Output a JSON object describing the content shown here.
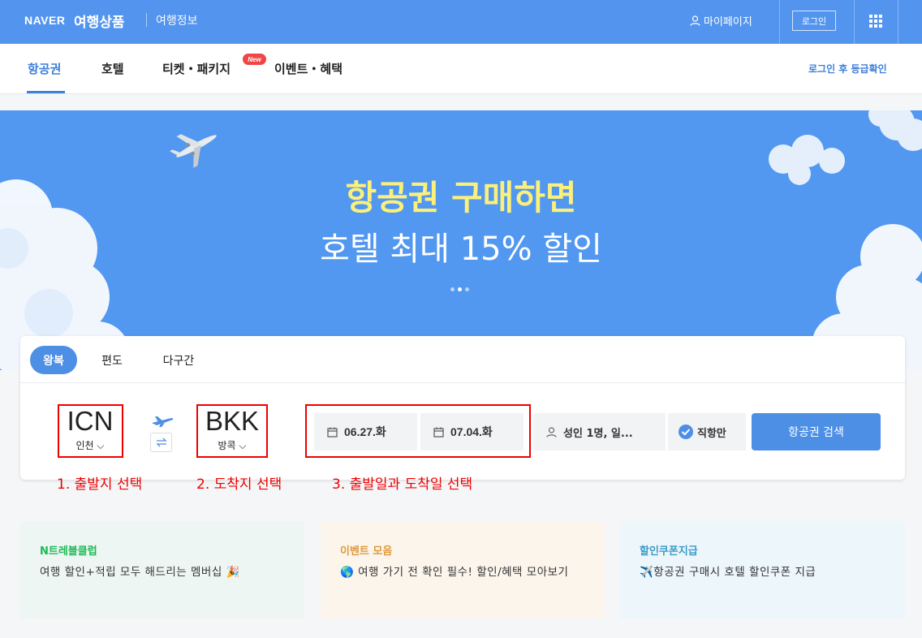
{
  "header": {
    "brand": "NAVER",
    "title": "여행상품",
    "info_link": "여행정보",
    "mypage": "마이페이지",
    "login": "로그인"
  },
  "nav": {
    "tabs": [
      {
        "label": "항공권",
        "active": true
      },
      {
        "label": "호텔"
      },
      {
        "label": "티켓・패키지",
        "badge": "New"
      },
      {
        "label": "이벤트・혜택"
      }
    ],
    "right_link": "로그인 후 등급확인"
  },
  "banner": {
    "line1": "항공권 구매하면",
    "line2": "호텔 최대 15% 할인",
    "slide_count": 3,
    "active_slide": 2
  },
  "search": {
    "trip_tabs": [
      "왕복",
      "편도",
      "다구간"
    ],
    "active_trip": "왕복",
    "origin": {
      "code": "ICN",
      "city": "인천"
    },
    "destination": {
      "code": "BKK",
      "city": "방콕"
    },
    "depart_date": "06.27.화",
    "return_date": "07.04.화",
    "passengers": "성인 1명, 일...",
    "direct_only": "직항만",
    "search_button": "항공권 검색"
  },
  "annotations": [
    "1. 출발지 선택",
    "2. 도착지 선택",
    "3. 출발일과 도착일 선택"
  ],
  "promo_cards": [
    {
      "title": "N트레블클럽",
      "desc": "여행 할인+적립 모두 해드리는 멤버십 🎉",
      "title_color": "#1db954",
      "bg": "#edf6f3"
    },
    {
      "title": "이벤트 모음",
      "desc": "🌎 여행 가기 전 확인 필수! 할인/혜택 모아보기",
      "title_color": "#e0993a",
      "bg": "#fbf5ec"
    },
    {
      "title": "할인쿠폰지급",
      "desc": "✈️항공권 구매시 호텔 할인쿠폰 지급",
      "title_color": "#3a9bc9",
      "bg": "#edf6fb"
    }
  ]
}
